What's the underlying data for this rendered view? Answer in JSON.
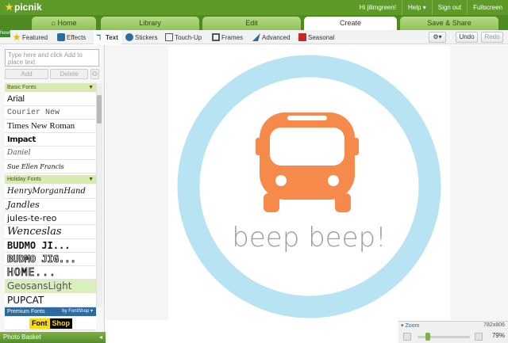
{
  "app": {
    "logo": "picnik"
  },
  "user_menu": {
    "greeting": "Hi jilimgreen!",
    "help": "Help ▾",
    "sign_out": "Sign out",
    "fullscreen": "Fullscreen"
  },
  "tabs": [
    {
      "label": "Home",
      "icon": "home-icon"
    },
    {
      "label": "Library"
    },
    {
      "label": "Edit"
    },
    {
      "label": "Create",
      "active": true
    },
    {
      "label": "Save & Share"
    }
  ],
  "subtabs": {
    "new_badge": "New!",
    "items": [
      {
        "label": "Featured",
        "icon": "star-icon"
      },
      {
        "label": "Effects",
        "icon": "effects-icon"
      },
      {
        "label": "Text",
        "icon": "text-icon",
        "active": true
      },
      {
        "label": "Stickers",
        "icon": "stickers-icon"
      },
      {
        "label": "Touch-Up",
        "icon": "touchup-icon"
      },
      {
        "label": "Frames",
        "icon": "frames-icon"
      },
      {
        "label": "Advanced",
        "icon": "advanced-icon"
      },
      {
        "label": "Seasonal",
        "icon": "seasonal-icon"
      }
    ],
    "undo": "Undo",
    "redo": "Redo"
  },
  "text_panel": {
    "placeholder": "Type here and click Add to place text",
    "add": "Add",
    "delete": "Delete"
  },
  "font_sections": {
    "basic": "Basic Fonts",
    "holiday": "Holiday Fonts",
    "premium": "Premium Fonts",
    "premium_by": "by FontShop ▾"
  },
  "basic_fonts": [
    "Arial",
    "Courier New",
    "Times New Roman",
    "Impact",
    "Daniel",
    "Sue Ellen Francis"
  ],
  "holiday_fonts": [
    "HenryMorganHand",
    "Jandles",
    "jules-te-reo",
    "Wenceslas",
    "BUDMO JI...",
    "BUDMO JIG...",
    "HOME...",
    "GeosansLight",
    "PUPCAT"
  ],
  "fontshop": {
    "left": "Font",
    "right": "Shop"
  },
  "photo_basket": "Photo Basket",
  "canvas": {
    "caption": "beep beep!",
    "colors": {
      "ring": "#b8e3f2",
      "bus": "#f58a4b",
      "text": "#9e9e9e"
    }
  },
  "zoom": {
    "label": "Zoom",
    "dims": "782x806",
    "percent": "79%",
    "level": 0.79
  }
}
